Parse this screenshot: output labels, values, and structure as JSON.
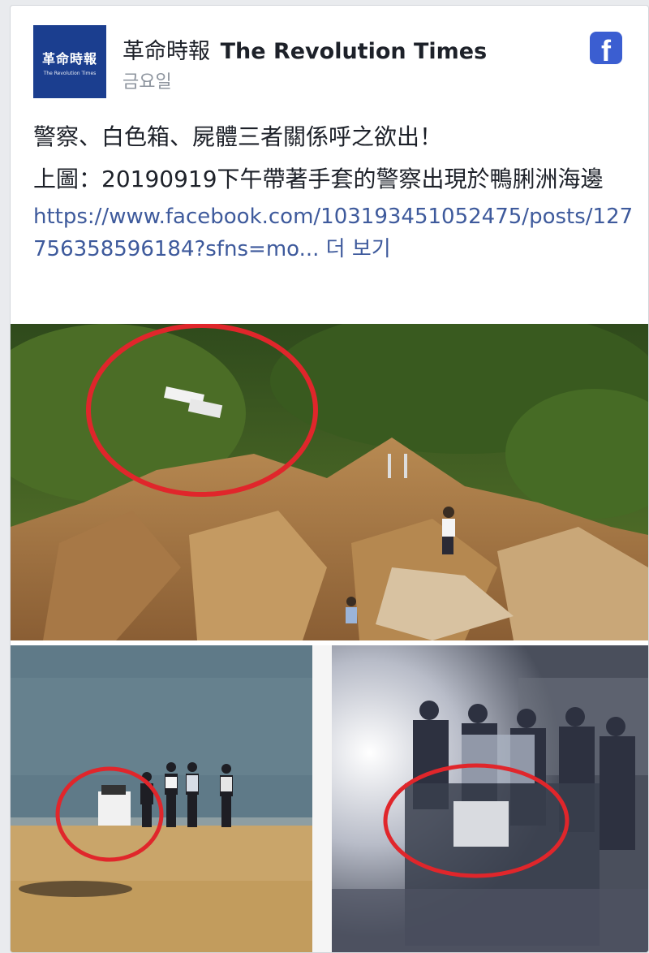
{
  "page": {
    "logo_text": "革命時報",
    "logo_subtext": "The Revolution Times",
    "name_cn": "革命時報",
    "name_en": "The Revolution Times",
    "timestamp": "금요일",
    "fb_icon": "facebook-icon"
  },
  "post": {
    "line1": "警察、白色箱、屍體三者關係呼之欲出！",
    "line2": "上圖：20190919下午帶著手套的警察出現於鴨脷洲海邊",
    "link": "https://www.facebook.com/103193451052475/posts/127756358596184?sfns=mo...",
    "see_more": " 더 보기"
  },
  "colors": {
    "fb_blue": "#3b5ed1",
    "link": "#3e5a9c",
    "logo_bg": "#1b3e8f",
    "circle": "#e0262b"
  }
}
